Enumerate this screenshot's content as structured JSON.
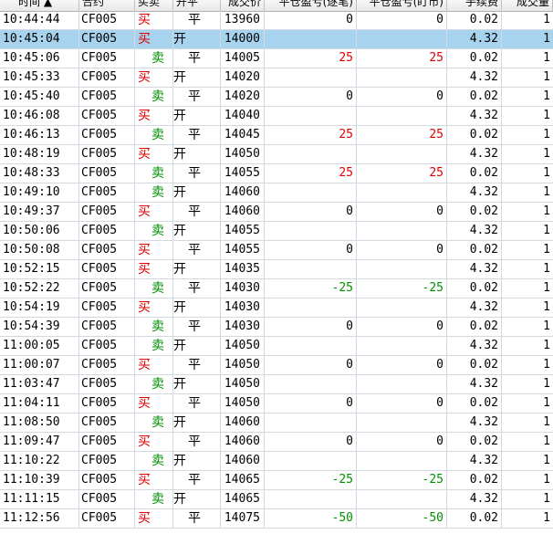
{
  "columns": {
    "time": "时间 ▲",
    "contract": "合约",
    "side": "买卖",
    "open_close": "开平",
    "price": "成交价",
    "pnl_trade": "平仓盈亏(逐笔)",
    "pnl_market": "平仓盈亏(盯市)",
    "fee": "手续费",
    "qty": "成交量"
  },
  "colors": {
    "buy": "#e00000",
    "sell": "#009000",
    "selected": "#a7d3ee"
  },
  "rows": [
    {
      "time": "10:44:44",
      "contract": "CF005",
      "side": "买",
      "side_type": "buy",
      "oc": "平",
      "oc_type": "close",
      "price": "13960",
      "pnl1": "0",
      "pnl2": "0",
      "pnl_sign": "",
      "fee": "0.02",
      "qty": "1",
      "selected": false
    },
    {
      "time": "10:45:04",
      "contract": "CF005",
      "side": "买",
      "side_type": "buy",
      "oc": "开",
      "oc_type": "open",
      "price": "14000",
      "pnl1": "",
      "pnl2": "",
      "pnl_sign": "",
      "fee": "4.32",
      "qty": "1",
      "selected": true
    },
    {
      "time": "10:45:06",
      "contract": "CF005",
      "side": "卖",
      "side_type": "sell",
      "oc": "平",
      "oc_type": "close",
      "price": "14005",
      "pnl1": "25",
      "pnl2": "25",
      "pnl_sign": "pos",
      "fee": "0.02",
      "qty": "1",
      "selected": false
    },
    {
      "time": "10:45:33",
      "contract": "CF005",
      "side": "买",
      "side_type": "buy",
      "oc": "开",
      "oc_type": "open",
      "price": "14020",
      "pnl1": "",
      "pnl2": "",
      "pnl_sign": "",
      "fee": "4.32",
      "qty": "1",
      "selected": false
    },
    {
      "time": "10:45:40",
      "contract": "CF005",
      "side": "卖",
      "side_type": "sell",
      "oc": "平",
      "oc_type": "close",
      "price": "14020",
      "pnl1": "0",
      "pnl2": "0",
      "pnl_sign": "",
      "fee": "0.02",
      "qty": "1",
      "selected": false
    },
    {
      "time": "10:46:08",
      "contract": "CF005",
      "side": "买",
      "side_type": "buy",
      "oc": "开",
      "oc_type": "open",
      "price": "14040",
      "pnl1": "",
      "pnl2": "",
      "pnl_sign": "",
      "fee": "4.32",
      "qty": "1",
      "selected": false
    },
    {
      "time": "10:46:13",
      "contract": "CF005",
      "side": "卖",
      "side_type": "sell",
      "oc": "平",
      "oc_type": "close",
      "price": "14045",
      "pnl1": "25",
      "pnl2": "25",
      "pnl_sign": "pos",
      "fee": "0.02",
      "qty": "1",
      "selected": false
    },
    {
      "time": "10:48:19",
      "contract": "CF005",
      "side": "买",
      "side_type": "buy",
      "oc": "开",
      "oc_type": "open",
      "price": "14050",
      "pnl1": "",
      "pnl2": "",
      "pnl_sign": "",
      "fee": "4.32",
      "qty": "1",
      "selected": false
    },
    {
      "time": "10:48:33",
      "contract": "CF005",
      "side": "卖",
      "side_type": "sell",
      "oc": "平",
      "oc_type": "close",
      "price": "14055",
      "pnl1": "25",
      "pnl2": "25",
      "pnl_sign": "pos",
      "fee": "0.02",
      "qty": "1",
      "selected": false
    },
    {
      "time": "10:49:10",
      "contract": "CF005",
      "side": "卖",
      "side_type": "sell",
      "oc": "开",
      "oc_type": "open",
      "price": "14060",
      "pnl1": "",
      "pnl2": "",
      "pnl_sign": "",
      "fee": "4.32",
      "qty": "1",
      "selected": false
    },
    {
      "time": "10:49:37",
      "contract": "CF005",
      "side": "买",
      "side_type": "buy",
      "oc": "平",
      "oc_type": "close",
      "price": "14060",
      "pnl1": "0",
      "pnl2": "0",
      "pnl_sign": "",
      "fee": "0.02",
      "qty": "1",
      "selected": false
    },
    {
      "time": "10:50:06",
      "contract": "CF005",
      "side": "卖",
      "side_type": "sell",
      "oc": "开",
      "oc_type": "open",
      "price": "14055",
      "pnl1": "",
      "pnl2": "",
      "pnl_sign": "",
      "fee": "4.32",
      "qty": "1",
      "selected": false
    },
    {
      "time": "10:50:08",
      "contract": "CF005",
      "side": "买",
      "side_type": "buy",
      "oc": "平",
      "oc_type": "close",
      "price": "14055",
      "pnl1": "0",
      "pnl2": "0",
      "pnl_sign": "",
      "fee": "0.02",
      "qty": "1",
      "selected": false
    },
    {
      "time": "10:52:15",
      "contract": "CF005",
      "side": "买",
      "side_type": "buy",
      "oc": "开",
      "oc_type": "open",
      "price": "14035",
      "pnl1": "",
      "pnl2": "",
      "pnl_sign": "",
      "fee": "4.32",
      "qty": "1",
      "selected": false
    },
    {
      "time": "10:52:22",
      "contract": "CF005",
      "side": "卖",
      "side_type": "sell",
      "oc": "平",
      "oc_type": "close",
      "price": "14030",
      "pnl1": "-25",
      "pnl2": "-25",
      "pnl_sign": "neg",
      "fee": "0.02",
      "qty": "1",
      "selected": false
    },
    {
      "time": "10:54:19",
      "contract": "CF005",
      "side": "买",
      "side_type": "buy",
      "oc": "开",
      "oc_type": "open",
      "price": "14030",
      "pnl1": "",
      "pnl2": "",
      "pnl_sign": "",
      "fee": "4.32",
      "qty": "1",
      "selected": false
    },
    {
      "time": "10:54:39",
      "contract": "CF005",
      "side": "卖",
      "side_type": "sell",
      "oc": "平",
      "oc_type": "close",
      "price": "14030",
      "pnl1": "0",
      "pnl2": "0",
      "pnl_sign": "",
      "fee": "0.02",
      "qty": "1",
      "selected": false
    },
    {
      "time": "11:00:05",
      "contract": "CF005",
      "side": "卖",
      "side_type": "sell",
      "oc": "开",
      "oc_type": "open",
      "price": "14050",
      "pnl1": "",
      "pnl2": "",
      "pnl_sign": "",
      "fee": "4.32",
      "qty": "1",
      "selected": false
    },
    {
      "time": "11:00:07",
      "contract": "CF005",
      "side": "买",
      "side_type": "buy",
      "oc": "平",
      "oc_type": "close",
      "price": "14050",
      "pnl1": "0",
      "pnl2": "0",
      "pnl_sign": "",
      "fee": "0.02",
      "qty": "1",
      "selected": false
    },
    {
      "time": "11:03:47",
      "contract": "CF005",
      "side": "卖",
      "side_type": "sell",
      "oc": "开",
      "oc_type": "open",
      "price": "14050",
      "pnl1": "",
      "pnl2": "",
      "pnl_sign": "",
      "fee": "4.32",
      "qty": "1",
      "selected": false
    },
    {
      "time": "11:04:11",
      "contract": "CF005",
      "side": "买",
      "side_type": "buy",
      "oc": "平",
      "oc_type": "close",
      "price": "14050",
      "pnl1": "0",
      "pnl2": "0",
      "pnl_sign": "",
      "fee": "0.02",
      "qty": "1",
      "selected": false
    },
    {
      "time": "11:08:50",
      "contract": "CF005",
      "side": "卖",
      "side_type": "sell",
      "oc": "开",
      "oc_type": "open",
      "price": "14060",
      "pnl1": "",
      "pnl2": "",
      "pnl_sign": "",
      "fee": "4.32",
      "qty": "1",
      "selected": false
    },
    {
      "time": "11:09:47",
      "contract": "CF005",
      "side": "买",
      "side_type": "buy",
      "oc": "平",
      "oc_type": "close",
      "price": "14060",
      "pnl1": "0",
      "pnl2": "0",
      "pnl_sign": "",
      "fee": "0.02",
      "qty": "1",
      "selected": false
    },
    {
      "time": "11:10:22",
      "contract": "CF005",
      "side": "卖",
      "side_type": "sell",
      "oc": "开",
      "oc_type": "open",
      "price": "14060",
      "pnl1": "",
      "pnl2": "",
      "pnl_sign": "",
      "fee": "4.32",
      "qty": "1",
      "selected": false
    },
    {
      "time": "11:10:39",
      "contract": "CF005",
      "side": "买",
      "side_type": "buy",
      "oc": "平",
      "oc_type": "close",
      "price": "14065",
      "pnl1": "-25",
      "pnl2": "-25",
      "pnl_sign": "neg",
      "fee": "0.02",
      "qty": "1",
      "selected": false
    },
    {
      "time": "11:11:15",
      "contract": "CF005",
      "side": "卖",
      "side_type": "sell",
      "oc": "开",
      "oc_type": "open",
      "price": "14065",
      "pnl1": "",
      "pnl2": "",
      "pnl_sign": "",
      "fee": "4.32",
      "qty": "1",
      "selected": false
    },
    {
      "time": "11:12:56",
      "contract": "CF005",
      "side": "买",
      "side_type": "buy",
      "oc": "平",
      "oc_type": "close",
      "price": "14075",
      "pnl1": "-50",
      "pnl2": "-50",
      "pnl_sign": "neg",
      "fee": "0.02",
      "qty": "1",
      "selected": false
    }
  ]
}
